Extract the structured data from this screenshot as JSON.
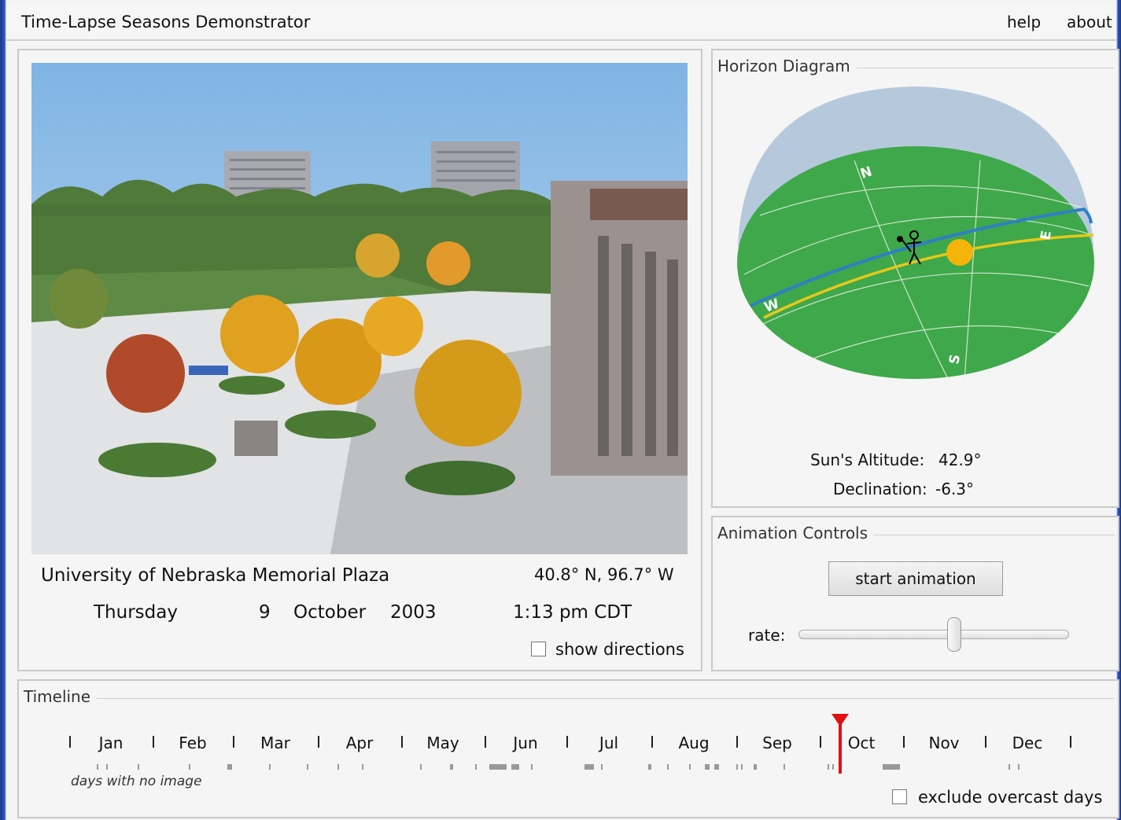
{
  "app": {
    "title": "Time-Lapse Seasons Demonstrator",
    "menu": {
      "help": "help",
      "about": "about"
    }
  },
  "scene": {
    "location": "University of Nebraska Memorial Plaza",
    "coords": "40.8° N, 96.7° W",
    "weekday": "Thursday",
    "day": "9",
    "month": "October",
    "year": "2003",
    "time": "1:13 pm CDT",
    "show_directions_label": "show directions",
    "show_directions_checked": false
  },
  "horizon": {
    "legend": "Horizon Diagram",
    "compass": {
      "n": "N",
      "e": "E",
      "s": "S",
      "w": "W"
    },
    "altitude_label": "Sun's Altitude:",
    "altitude_value": "42.9°",
    "declination_label": "Declination:",
    "declination_value": "-6.3°"
  },
  "animation": {
    "legend": "Animation Controls",
    "start_button": "start animation",
    "rate_label": "rate:",
    "rate_fraction": 0.58
  },
  "timeline": {
    "legend": "Timeline",
    "months": [
      "Jan",
      "Feb",
      "Mar",
      "Apr",
      "May",
      "Jun",
      "Jul",
      "Aug",
      "Sep",
      "Oct",
      "Nov",
      "Dec"
    ],
    "no_image_caption": "days with no image",
    "exclude_overcast_label": "exclude overcast days",
    "exclude_overcast_checked": false,
    "current_date": "9 October"
  },
  "colors": {
    "sky_dome": "#b6c9dc",
    "ground": "#3fa84a",
    "celestial_equator": "#2f7fc4",
    "sun_path": "#e8c81a",
    "sun": "#f5b40a",
    "marker": "#e01010"
  }
}
